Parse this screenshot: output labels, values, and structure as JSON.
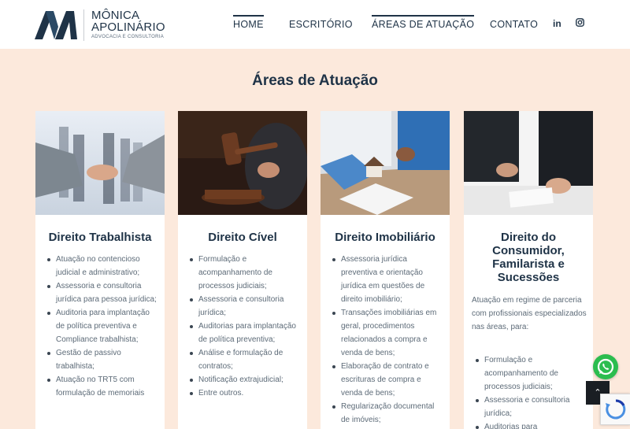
{
  "brand": {
    "name_line1": "MÔNICA",
    "name_line2": "APOLINÁRIO",
    "subtitle": "ADVOCACIA E CONSULTORIA",
    "color": "#1f3347"
  },
  "nav": {
    "items": [
      {
        "label": "HOME",
        "active": true
      },
      {
        "label": "ESCRITÓRIO",
        "active": false
      },
      {
        "label": "ÁREAS DE ATUAÇÃO",
        "active": true
      },
      {
        "label": "CONTATO",
        "active": false
      }
    ],
    "social": {
      "linkedin": "in",
      "instagram": "instagram-icon"
    }
  },
  "section": {
    "title": "Áreas de Atuação"
  },
  "cards": [
    {
      "title": "Direito Trabalhista",
      "image": "handshake-photo",
      "items": [
        "Atuação no contencioso judicial e administrativo;",
        "Assessoria e consultoria jurídica para pessoa jurídica;",
        "Auditoria para implantação de política preventiva e Compliance trabalhista;",
        "Gestão de passivo trabalhista;",
        "Atuação no TRT5 com formulação de memoriais"
      ]
    },
    {
      "title": "Direito Cível",
      "image": "gavel-photo",
      "items": [
        "Formulação e acompanhamento de processos judiciais;",
        "Assessoria e consultoria jurídica;",
        "Auditorias para implantação de política preventiva;",
        "Análise e formulação de contratos;",
        "Notificação extrajudicial;",
        "Entre outros."
      ]
    },
    {
      "title": "Direito Imobiliário",
      "image": "house-keys-photo",
      "items": [
        "Assessoria jurídica preventiva e orientação jurídica em questões de direito imobiliário;",
        "Transações imobiliárias em geral, procedimentos relacionados a compra e venda de bens;",
        "Elaboração de contrato e escrituras de compra e venda de bens;",
        "Regularização documental de imóveis;"
      ]
    },
    {
      "title": "Direito do Consumidor, Familarista e Sucessões",
      "image": "consultation-photo",
      "intro": "Atuação em regime de parceria com profissionais especializados nas áreas, para:",
      "items": [
        "Formulação e acompanhamento de processos judiciais;",
        "Assessoria e consultoria jurídica;",
        "Auditorias para"
      ]
    }
  ],
  "floating": {
    "whatsapp": "whatsapp-icon",
    "to_top": "chevron-up-icon",
    "to_top_glyph": "⌃"
  }
}
